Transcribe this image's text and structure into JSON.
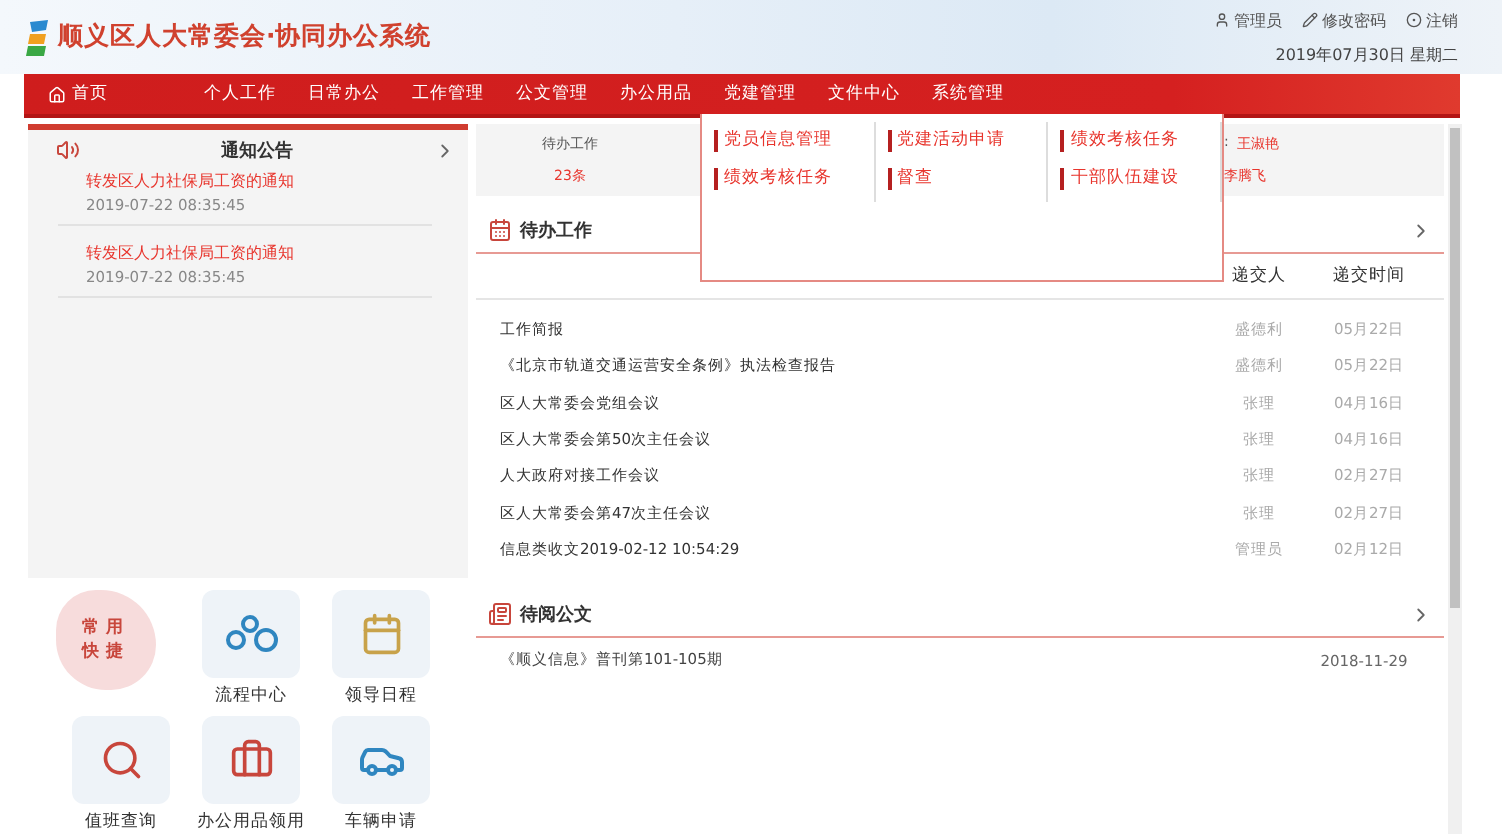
{
  "header": {
    "title": "顺义区人大常委会·协同办公系统",
    "user_links": [
      {
        "kind": "user",
        "label": "管理员"
      },
      {
        "kind": "password",
        "label": "修改密码"
      },
      {
        "kind": "logout",
        "label": "注销"
      }
    ],
    "date": "2019年07月30日 星期二"
  },
  "nav": [
    {
      "kind": "home",
      "label": "首页"
    },
    {
      "kind": "menu",
      "label": "个人工作"
    },
    {
      "kind": "menu",
      "label": "日常办公"
    },
    {
      "kind": "menu",
      "label": "工作管理"
    },
    {
      "kind": "menu",
      "label": "公文管理"
    },
    {
      "kind": "menu",
      "label": "办公用品"
    },
    {
      "kind": "menu",
      "label": "党建管理"
    },
    {
      "kind": "menu",
      "label": "文件中心"
    },
    {
      "kind": "menu",
      "label": "系统管理"
    }
  ],
  "dropdown": {
    "columns": [
      [
        "党员信息管理",
        "绩效考核任务"
      ],
      [
        "党建活动申请",
        "督查"
      ],
      [
        "绩效考核任务",
        "干部队伍建设"
      ]
    ]
  },
  "notices": {
    "title": "通知公告",
    "items": [
      {
        "title": "转发区人力社保局工资的通知",
        "time": "2019-07-22 08:35:45"
      },
      {
        "title": "转发区人力社保局工资的通知",
        "time": "2019-07-22 08:35:45"
      }
    ]
  },
  "quick": {
    "badge": [
      "常用",
      "快捷"
    ],
    "items": [
      {
        "kind": "flow",
        "label": "流程中心"
      },
      {
        "kind": "calendar",
        "label": "领导日程"
      },
      {
        "kind": "search",
        "label": "值班查询"
      },
      {
        "kind": "supplies",
        "label": "办公用品领用"
      },
      {
        "kind": "car",
        "label": "车辆申请"
      }
    ]
  },
  "summary": {
    "label": "待办工作",
    "count": "23条",
    "separator": ":",
    "names": [
      "王淑艳",
      "李腾飞"
    ]
  },
  "pending": {
    "title": "待办工作",
    "columns": [
      "递交人",
      "递交时间"
    ],
    "rows": [
      {
        "title": "工作简报",
        "submitter": "盛德利",
        "time": "05月22日"
      },
      {
        "title": "《北京市轨道交通运营安全条例》执法检查报告",
        "submitter": "盛德利",
        "time": "05月22日"
      },
      {
        "title": "区人大常委会党组会议",
        "submitter": "张理",
        "time": "04月16日"
      },
      {
        "title": "区人大常委会第50次主任会议",
        "submitter": "张理",
        "time": "04月16日"
      },
      {
        "title": "人大政府对接工作会议",
        "submitter": "张理",
        "time": "02月27日"
      },
      {
        "title": "区人大常委会第47次主任会议",
        "submitter": "张理",
        "time": "02月27日"
      },
      {
        "title": "信息类收文2019-02-12 10:54:29",
        "submitter": "管理员",
        "time": "02月12日"
      }
    ]
  },
  "reading": {
    "title": "待阅公文",
    "rows": [
      {
        "title": "《顺义信息》普刊第101-105期",
        "date": "2018-11-29"
      }
    ]
  }
}
